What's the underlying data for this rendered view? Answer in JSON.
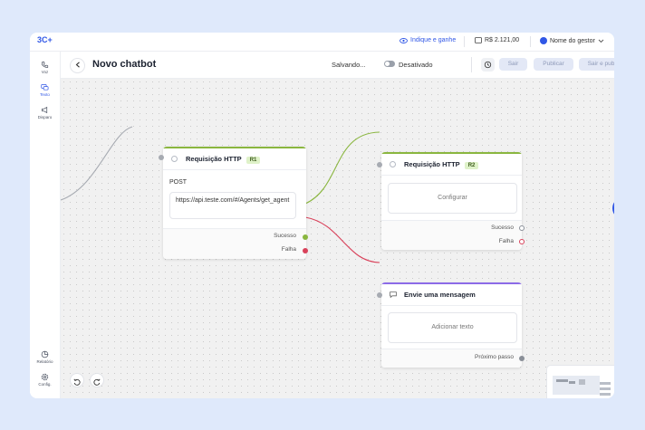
{
  "app": {
    "logo": "3C",
    "referral_link": "Indique e ganhe",
    "balance": "R$ 2.121,00",
    "user_name": "Nome do gestor"
  },
  "sidebar": {
    "items": [
      {
        "label": "Voz",
        "icon": "phone-icon"
      },
      {
        "label": "Texto",
        "icon": "chat-icon"
      },
      {
        "label": "Disparo",
        "icon": "megaphone-icon"
      },
      {
        "label": "Relatório",
        "icon": "report-icon"
      },
      {
        "label": "Config.",
        "icon": "gear-icon"
      }
    ]
  },
  "header": {
    "title": "Novo chatbot",
    "status": "Salvando...",
    "toggle_label": "Desativado",
    "exit_label": "Sair",
    "publish_label": "Publicar",
    "exit_publish_label": "Sair e publicar"
  },
  "nodes": {
    "http1": {
      "title": "Requisição HTTP",
      "badge": "R1",
      "method": "POST",
      "url": "https://api.teste.com/#/Agents/get_agent",
      "success_label": "Sucesso",
      "failure_label": "Falha"
    },
    "http2": {
      "title": "Requisição HTTP",
      "badge": "R2",
      "configure_label": "Configurar",
      "success_label": "Sucesso",
      "failure_label": "Falha"
    },
    "message": {
      "title": "Envie uma mensagem",
      "text_placeholder": "Adicionar texto",
      "next_label": "Próximo passo"
    }
  },
  "colors": {
    "accent": "#3057e6",
    "success_edge": "#8ab63f",
    "failure_edge": "#d9415a",
    "message_accent": "#8c6be8"
  }
}
